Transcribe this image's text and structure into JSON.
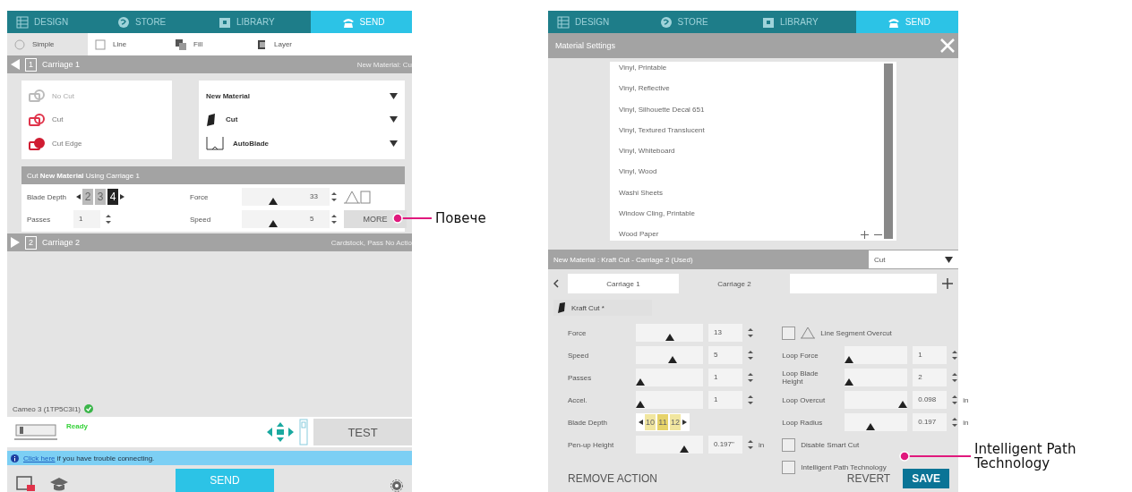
{
  "left_panel": {
    "nav_tabs": [
      {
        "label": "DESIGN",
        "selected": false
      },
      {
        "label": "STORE",
        "selected": false
      },
      {
        "label": "LIBRARY",
        "selected": false
      },
      {
        "label": "SEND",
        "selected": true
      }
    ],
    "mode_tabs": [
      {
        "label": "Simple",
        "selected": true
      },
      {
        "label": "Line",
        "selected": false
      },
      {
        "label": "Fill",
        "selected": false
      },
      {
        "label": "Layer",
        "selected": false
      }
    ],
    "carriage_1": {
      "number": "1",
      "title": "Carriage 1",
      "material": "New Material: Cu",
      "expanded": true
    },
    "actions": [
      {
        "kind": "no-cut",
        "label": "No Cut"
      },
      {
        "kind": "cut",
        "label": "Cut"
      },
      {
        "kind": "cut-edge",
        "label": "Cut Edge"
      }
    ],
    "dropdowns": [
      {
        "kind": "material",
        "label": "New Material"
      },
      {
        "kind": "action",
        "label": "Cut"
      },
      {
        "kind": "tool",
        "label": "AutoBlade"
      }
    ],
    "summary": "Cut **New Material** Using Carriage 1",
    "blade_depth": {
      "label": "Blade Depth",
      "values": [
        {
          "text": "2",
          "selected": false
        },
        {
          "text": "3",
          "selected": false
        },
        {
          "text": "4",
          "selected": true
        }
      ]
    },
    "passes": {
      "label": "Passes",
      "value": "1"
    },
    "force": {
      "label": "Force",
      "level": 0.5,
      "value": "33"
    },
    "speed": {
      "label": "Speed",
      "level": 0.5,
      "value": "5"
    },
    "more_button": "MORE",
    "carriage_2": {
      "number": "2",
      "title": "Carriage 2",
      "material": "Cardstock, Pass No Actio",
      "expanded": false
    },
    "machine": "Cameo 3 (1TP5C3I1)",
    "status": "Ready",
    "test_button": "TEST",
    "info_link": "Click here",
    "info_text": "if you have trouble connecting.",
    "send_button": "SEND"
  },
  "right_panel": {
    "nav_tabs": [
      {
        "label": "DESIGN",
        "selected": false
      },
      {
        "label": "STORE",
        "selected": false
      },
      {
        "label": "LIBRARY",
        "selected": false
      },
      {
        "label": "SEND",
        "selected": true
      }
    ],
    "title": "Material Settings",
    "materials": [
      "Vinyl, Printable",
      "Vinyl, Reflective",
      "Vinyl, Silhouette Decal 651",
      "Vinyl, Textured Translucent",
      "Vinyl, Whiteboard",
      "Vinyl, Wood",
      "Washi Sheets",
      "Window Cling, Printable",
      "Wood Paper"
    ],
    "header": "New Material : Kraft Cut - Carriage 2 (Used)",
    "action_dropdown": "Cut",
    "carriage_tabs": [
      {
        "label": "Carriage 1",
        "selected": false
      },
      {
        "label": "Carriage 2",
        "selected": true
      }
    ],
    "action_tab": "Kraft Cut *",
    "left_params": [
      {
        "kind": "slider",
        "label": "Force",
        "level": 0.5,
        "value": "13"
      },
      {
        "kind": "slider",
        "label": "Speed",
        "level": 0.55,
        "value": "5"
      },
      {
        "kind": "slider",
        "label": "Passes",
        "level": 0,
        "value": "1"
      },
      {
        "kind": "slider",
        "label": "Accel.",
        "level": 0,
        "value": "1"
      },
      {
        "kind": "blade",
        "label": "Blade Depth",
        "values": [
          {
            "text": "10",
            "selected": false
          },
          {
            "text": "11",
            "selected": true
          },
          {
            "text": "12",
            "selected": false
          }
        ]
      },
      {
        "kind": "slider",
        "label": "Pen-up Height",
        "level": 0.75,
        "value": "0.197\"",
        "unit": "in"
      }
    ],
    "right_params": [
      {
        "kind": "check-icon",
        "label": "Line Segment Overcut",
        "checked": false
      },
      {
        "kind": "slider",
        "label": "Loop Force",
        "level": 0,
        "value": "1"
      },
      {
        "kind": "slider",
        "label": "Loop Blade Height",
        "level": 0,
        "value": "2"
      },
      {
        "kind": "slider",
        "label": "Loop Overcut",
        "level": 1,
        "value": "0.098",
        "unit": "in"
      },
      {
        "kind": "slider",
        "label": "Loop Radius",
        "level": 0.4,
        "value": "0.197",
        "unit": "in"
      },
      {
        "kind": "checkbox",
        "label": "Disable Smart Cut",
        "checked": false
      },
      {
        "kind": "checkbox",
        "label": "Intelligent Path Technology",
        "checked": false
      }
    ],
    "remove_button": "REMOVE ACTION",
    "revert_button": "REVERT",
    "save_button": "SAVE"
  },
  "callouts": [
    {
      "text": "Повече"
    },
    {
      "text": "Intelligent Path Technology"
    }
  ]
}
